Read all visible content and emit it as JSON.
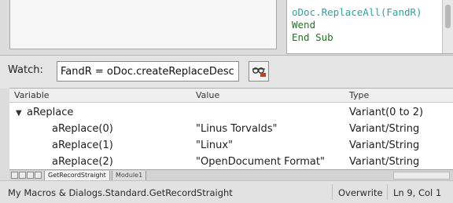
{
  "editor": {
    "code_lines": [
      "oDoc.ReplaceAll(FandR)",
      "Wend",
      "End Sub"
    ]
  },
  "watch": {
    "label": "Watch:",
    "input_value": "FandR = oDoc.createReplaceDesc"
  },
  "tree": {
    "columns": [
      "Variable",
      "Value",
      "Type"
    ],
    "rows": [
      {
        "variable": "aReplace",
        "value": "",
        "type": "Variant(0 to 2)",
        "expanded": true
      },
      {
        "variable": "aReplace(0)",
        "value": "\"Linus Torvalds\"",
        "type": "Variant/String"
      },
      {
        "variable": "aReplace(1)",
        "value": "\"Linux\"",
        "type": "Variant/String"
      },
      {
        "variable": "aReplace(2)",
        "value": "\"OpenDocument Format\"",
        "type": "Variant/String"
      }
    ]
  },
  "tabs": [
    "GetRecordStraight",
    "Module1"
  ],
  "status": {
    "library_path": "My Macros & Dialogs.Standard.GetRecordStraight",
    "mode": "Overwrite",
    "position": "Ln 9, Col 1"
  },
  "colors": {
    "code_call": "#2aa3a3",
    "code_keyword": "#1a7a1a",
    "remove_icon_red": "#d33a1a"
  }
}
